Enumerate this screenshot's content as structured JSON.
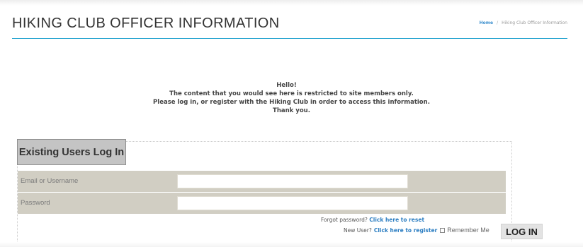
{
  "header": {
    "title": "HIKING CLUB OFFICER INFORMATION",
    "breadcrumb": {
      "home": "Home",
      "separator": "/",
      "current": "Hiking Club Officer Information"
    }
  },
  "notice": {
    "lines": [
      "Hello!",
      "The content that you would see here is restricted to site members only.",
      "Please log in, or register with the Hiking Club in order to access this information.",
      "Thank you."
    ]
  },
  "login": {
    "header": "Existing Users Log In",
    "fields": [
      {
        "label": "Email or Username",
        "value": "",
        "placeholder": ""
      },
      {
        "label": "Password",
        "value": "",
        "placeholder": ""
      }
    ],
    "forgot_text": "Forgot password?",
    "forgot_link": "Click here to reset",
    "new_user_text": "New User?",
    "register_link": "Click here to register",
    "remember_label": "Remember Me",
    "button_label": "LOG IN"
  },
  "colors": {
    "accent_rule": "#23a3cf",
    "link": "#2c7ec2",
    "form_row_bg": "#d1cec3",
    "header_box_bg": "#c4c4c4"
  }
}
